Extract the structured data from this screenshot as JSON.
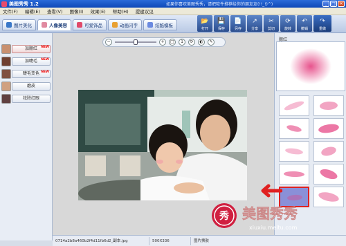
{
  "window": {
    "title": "美图秀秀 1.2",
    "promo": "如果你喜欢美图秀秀，请把软件推荐给你的朋友友(!!_!)^)",
    "buttons": [
      "_",
      "□",
      "×"
    ]
  },
  "menu": [
    "文件(F)",
    "编辑(E)",
    "查看(V)",
    "图像(I)",
    "效果(E)",
    "帮助(H)",
    "提建议见"
  ],
  "tabs": [
    {
      "label": "图片美化",
      "icon": "picture-icon",
      "color": "#3a78c8"
    },
    {
      "label": "人像美容",
      "icon": "face-icon",
      "color": "#e08aa0",
      "active": true
    },
    {
      "label": "可爱饰品",
      "icon": "heart-icon",
      "color": "#e04a6a"
    },
    {
      "label": "动画闪字",
      "icon": "sparkle-icon",
      "color": "#e8a030"
    },
    {
      "label": "炫酷模板",
      "icon": "template-icon",
      "color": "#6a8ae0"
    }
  ],
  "toolbar": [
    {
      "label": "打开",
      "icon": "folder-icon",
      "glyph": "📂"
    },
    {
      "label": "保存",
      "icon": "save-icon",
      "glyph": "💾"
    },
    {
      "label": "另存",
      "icon": "save-as-icon",
      "glyph": "📄"
    },
    {
      "label": "分享",
      "icon": "share-icon",
      "glyph": "↗"
    },
    {
      "label": "剪切",
      "icon": "scissors-icon",
      "glyph": "✂"
    },
    {
      "label": "旋转",
      "icon": "rotate-icon",
      "glyph": "⟳"
    },
    {
      "label": "撤销",
      "icon": "undo-icon",
      "glyph": "↶"
    },
    {
      "label": "重做",
      "icon": "redo-icon",
      "glyph": "↷"
    }
  ],
  "left_tools": [
    {
      "label": "加腮红",
      "thumb_color": "#c89070",
      "new": true,
      "active": true
    },
    {
      "label": "加睫毛",
      "thumb_color": "#704030",
      "new": true
    },
    {
      "label": "睫毛变色",
      "thumb_color": "#805040",
      "new": true
    },
    {
      "label": "磨皮",
      "thumb_color": "#d0a080"
    },
    {
      "label": "祛除红眼",
      "thumb_color": "#604040"
    }
  ],
  "new_badge": "NEW",
  "right_panel": {
    "label": "腮红",
    "brushes": 10,
    "accent": "#e44080"
  },
  "status": {
    "filename": "0714a2b8a460b2f4d11fb6d2_副本.jpg",
    "size": "500X336",
    "action": "图片换肤"
  },
  "watermark": {
    "logo_char": "秀",
    "brand": "美图秀秀",
    "url": "xiuxiu.meitu.com"
  }
}
